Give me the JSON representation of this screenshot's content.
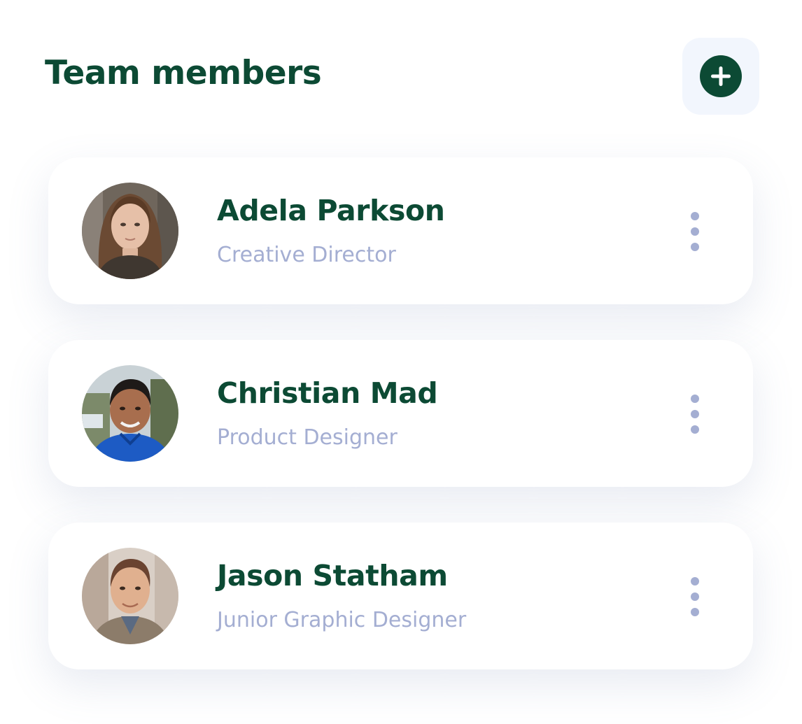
{
  "header": {
    "title": "Team members"
  },
  "colors": {
    "title": "#0c4a34",
    "role": "#a4aed2",
    "add_button_bg": "#f2f6fd",
    "add_icon": "#0c4a34"
  },
  "icons": {
    "add": "plus-circle-icon",
    "more": "more-vertical-icon"
  },
  "members": [
    {
      "name": "Adela Parkson",
      "role": "Creative Director"
    },
    {
      "name": "Christian Mad",
      "role": "Product Designer"
    },
    {
      "name": "Jason Statham",
      "role": "Junior Graphic Designer"
    }
  ]
}
